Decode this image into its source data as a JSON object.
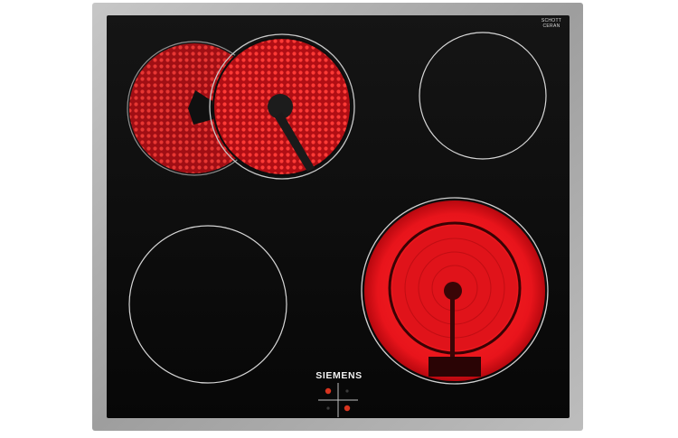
{
  "product": {
    "brand": "SIEMENS",
    "glass_brand_line1": "SCHOTT",
    "glass_brand_line2": "CERAN",
    "model_label": "",
    "glass_type_label": ""
  },
  "zones": [
    {
      "name": "front-left",
      "state": "off"
    },
    {
      "name": "rear-left-dual",
      "state": "on"
    },
    {
      "name": "rear-right",
      "state": "off"
    },
    {
      "name": "front-right-dual",
      "state": "on"
    }
  ],
  "colors": {
    "glass": "#0d0d0d",
    "frame": "#a9a9a9",
    "heat": "#e8141b",
    "ring": "#d0d0d0",
    "indicator": "#d8341f"
  }
}
